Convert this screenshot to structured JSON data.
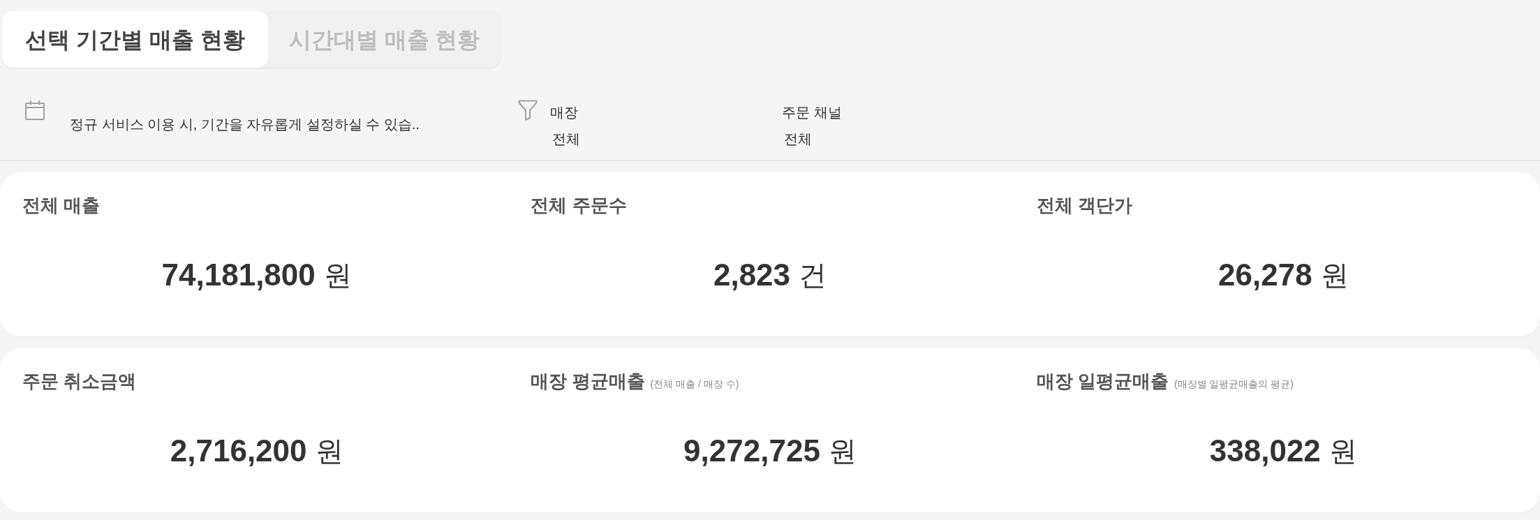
{
  "tabs": [
    {
      "label": "선택 기간별 매출 현황",
      "selected": true
    },
    {
      "label": "시간대별 매출 현황",
      "selected": false
    }
  ],
  "filter_bar": {
    "date_range": {
      "text": "정규 서비스 이용 시, 기간을 자유롭게 설정하실 수 있습.."
    },
    "filters": [
      {
        "label": "매장",
        "value": "전체"
      },
      {
        "label": "주문 채널",
        "value": "전체"
      }
    ]
  },
  "summary_cards": [
    {
      "metrics": [
        {
          "title": "전체 매출",
          "value": "74,181,800",
          "unit": "원"
        },
        {
          "title": "전체 주문수",
          "value": "2,823",
          "unit": "건"
        },
        {
          "title": "전체 객단가",
          "value": "26,278",
          "unit": "원"
        }
      ]
    },
    {
      "metrics": [
        {
          "title": "주문 취소금액",
          "value": "2,716,200",
          "unit": "원"
        },
        {
          "title": "매장 평균매출",
          "note": "(전체 매출 / 매장 수)",
          "value": "9,272,725",
          "unit": "원"
        },
        {
          "title": "매장 일평균매출",
          "note": "(매장별 일평균매출의 평균)",
          "value": "338,022",
          "unit": "원"
        }
      ]
    }
  ]
}
